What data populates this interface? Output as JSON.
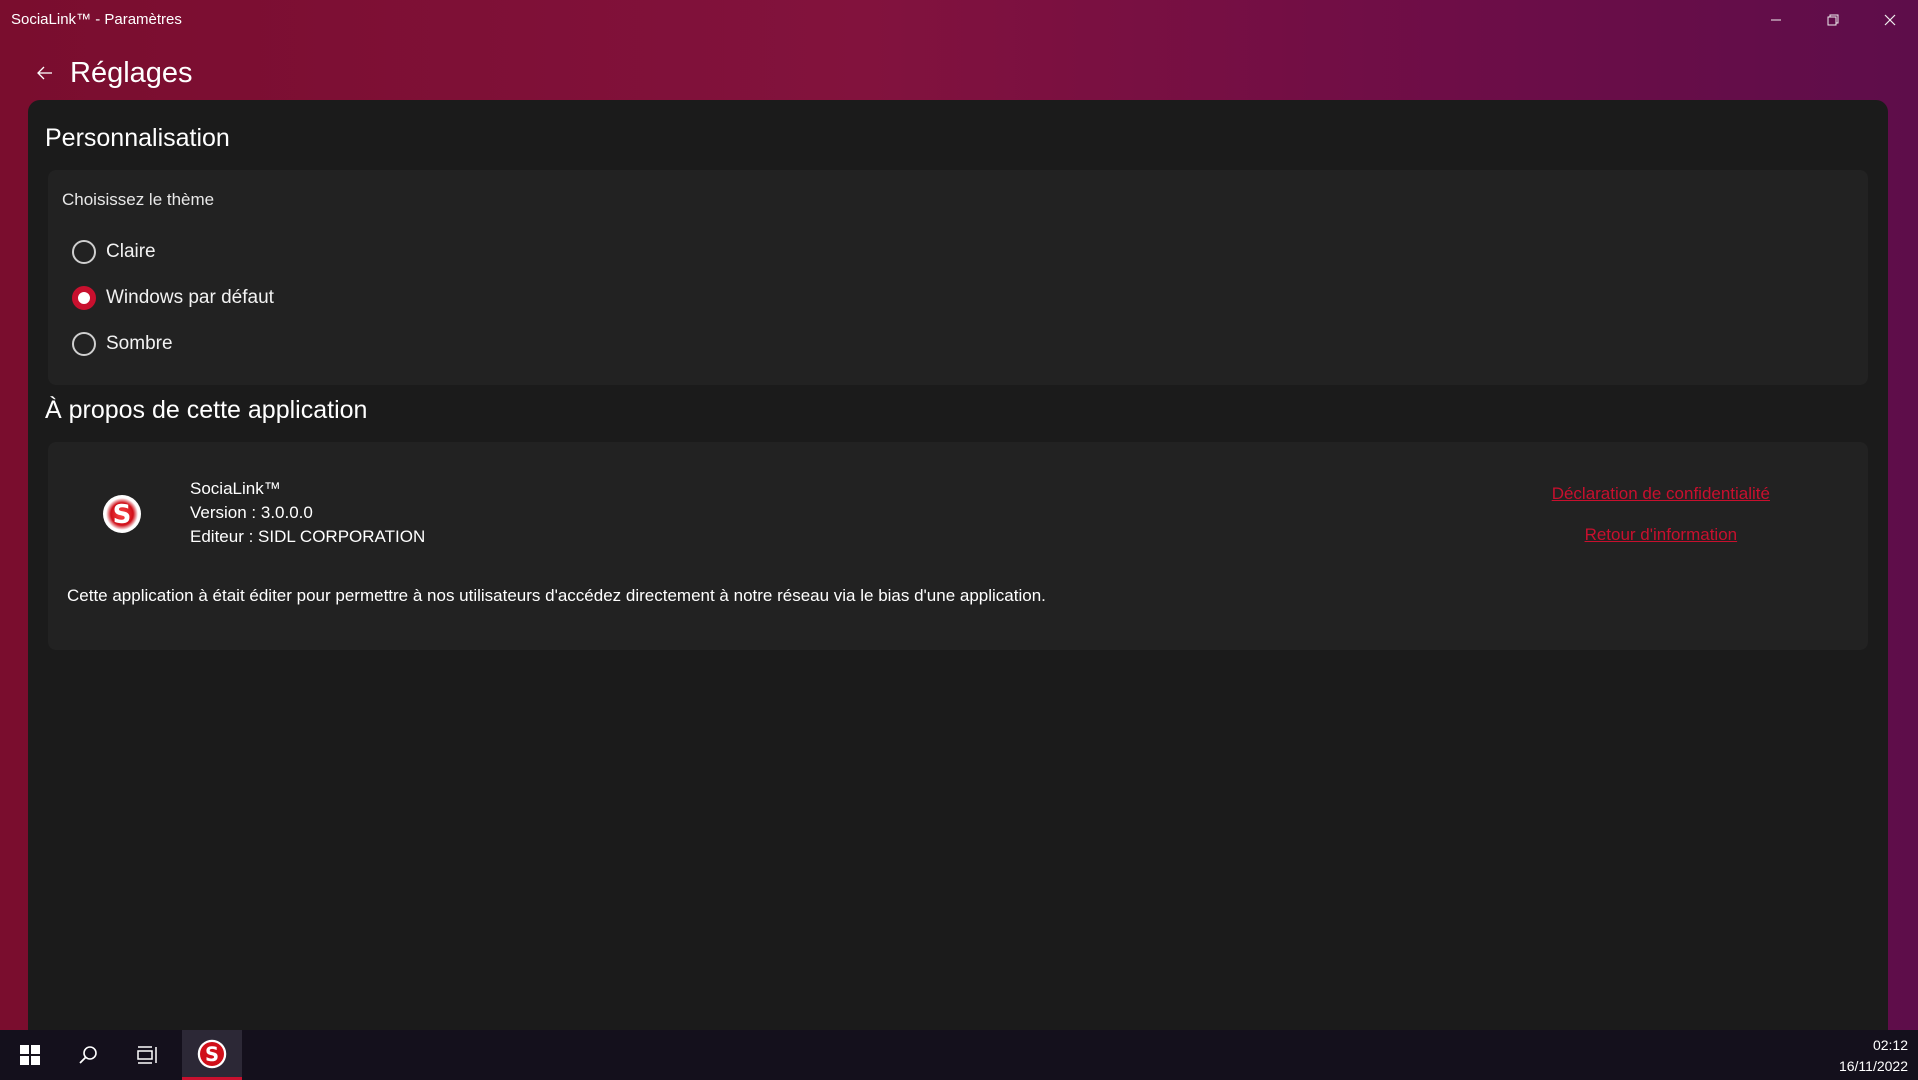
{
  "window": {
    "title": "SociaLink™ - Paramètres",
    "controls": {
      "minimize_icon": "minimize-icon",
      "restore_icon": "restore-icon",
      "close_icon": "close-icon"
    }
  },
  "header": {
    "back_icon": "back-arrow-icon",
    "title": "Réglages"
  },
  "personalization": {
    "section_title": "Personnalisation",
    "theme_label": "Choisissez le thème",
    "options": [
      {
        "label": "Claire",
        "selected": false
      },
      {
        "label": "Windows par défaut",
        "selected": true
      },
      {
        "label": "Sombre",
        "selected": false
      }
    ]
  },
  "about": {
    "section_title": "À propos de cette application",
    "app_name": "SociaLink™",
    "version": "Version : 3.0.0.0",
    "publisher": "Editeur : SIDL CORPORATION",
    "links": {
      "privacy": "Déclaration de confidentialité",
      "feedback": "Retour d'information"
    },
    "description": "Cette application à était éditer pour permettre à nos utilisateurs d'accédez directement à notre réseau via le bias d'une application.",
    "logo_letter": "S"
  },
  "taskbar": {
    "start_icon": "windows-start-icon",
    "search_icon": "search-icon",
    "taskview_icon": "task-view-icon",
    "app_icon": "socialink-app-icon",
    "time": "02:12",
    "date": "16/11/2022"
  },
  "colors": {
    "accent": "#c8102e",
    "background_gradient_start": "#7a0d2e",
    "background_gradient_end": "#5e0d4a",
    "panel": "#1b1b1b",
    "card": "#222222"
  }
}
